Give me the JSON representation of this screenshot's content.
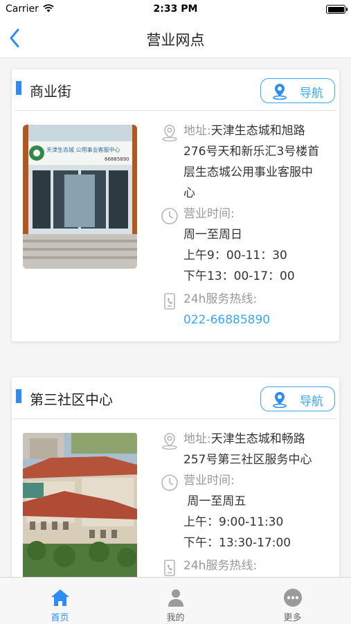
{
  "status": {
    "carrier": "Carrier",
    "time": "2:33 PM"
  },
  "nav": {
    "title": "营业网点"
  },
  "colors": {
    "accent": "#2c8df4",
    "link": "#3aa6f3"
  },
  "outlets": [
    {
      "name": "商业街",
      "nav_label": "导航",
      "address_label": "地址:",
      "address_lines": [
        "天津生态城和旭路",
        "276号天和新乐汇3号楼首",
        "层生态城公用事业客服中",
        "心"
      ],
      "hours_label": "营业时间:",
      "hours_lines": [
        "周一至周日",
        "上午9：00-11：30",
        "下午13：00-17：00"
      ],
      "hotline_label": "24h服务热线:",
      "phone": "022-66885890",
      "photo_sign": "天津生态城  公用事业客服中心",
      "photo_sign_phone": "66885890"
    },
    {
      "name": "第三社区中心",
      "nav_label": "导航",
      "address_label": "地址:",
      "address_lines": [
        "天津生态城和畅路",
        "257号第三社区服务中心"
      ],
      "hours_label": "营业时间:",
      "hours_lines": [
        " 周一至周五",
        "上午：9:00-11:30",
        "下午：13:30-17:00"
      ],
      "hotline_label": "24h服务热线:"
    }
  ],
  "tabs": [
    {
      "label": "首页",
      "icon": "home-icon",
      "active": true
    },
    {
      "label": "我的",
      "icon": "user-icon",
      "active": false
    },
    {
      "label": "更多",
      "icon": "more-icon",
      "active": false
    }
  ]
}
